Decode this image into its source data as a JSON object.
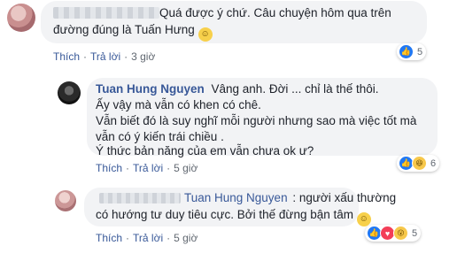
{
  "comments": [
    {
      "text_line1": "Quá được ý chứ. Câu chuyện hôm qua trên",
      "text_line2": "đường đúng là Tuấn Hưng",
      "like_label": "Thích",
      "reply_label": "Trả lời",
      "time": "3 giờ",
      "reaction_count": "5"
    },
    {
      "author": "Tuan Hung Nguyen",
      "lines": [
        "Vâng anh. Đời ... chỉ là thế thôi.",
        "Ấy vậy mà vẫn có khen có chê.",
        "Vẫn biết đó là suy nghĩ mỗi người nhưng sao mà việc tốt mà",
        "vẫn có ý kiến trái chiều .",
        "Ý thức bản năng của em vẫn chưa ok ư?"
      ],
      "like_label": "Thích",
      "reply_label": "Trả lời",
      "time": "5 giờ",
      "reaction_count": "6"
    },
    {
      "author": "Tuan Hung Nguyen",
      "text_after_author": ": người xấu thường",
      "text_line2": "có hướng tư duy tiêu cực. Bởi thế đừng bận tâm",
      "like_label": "Thích",
      "reply_label": "Trả lời",
      "time": "5 giờ",
      "reaction_count": "5"
    }
  ],
  "icons": {
    "smile": "☺",
    "like": "👍",
    "haha": "😆",
    "love": "♥",
    "wow": "😮"
  },
  "colors": {
    "bubble": "#f2f3f5",
    "name": "#385898",
    "like_blue": "#2078f4"
  }
}
